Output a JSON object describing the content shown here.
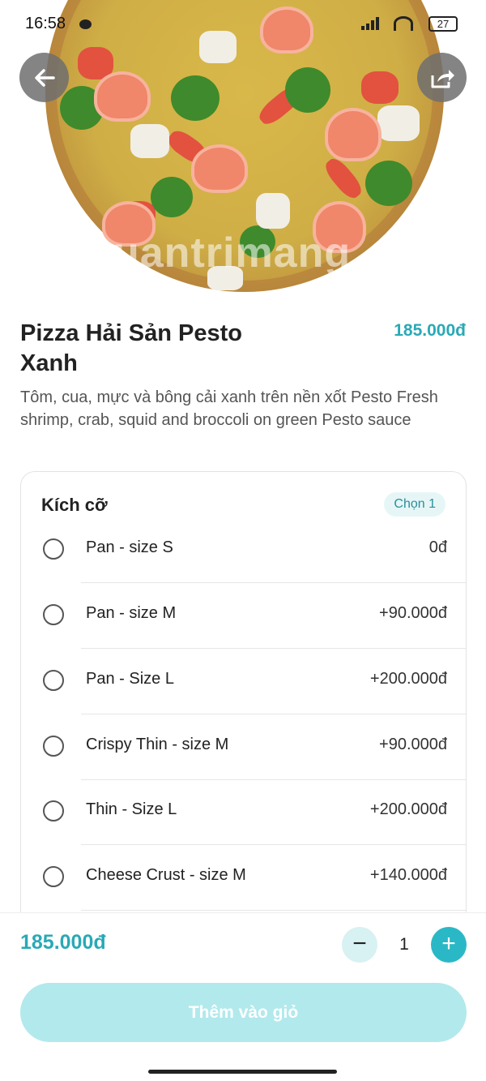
{
  "status_bar": {
    "time": "16:58",
    "battery": "27"
  },
  "hero": {
    "watermark": "uantrimang"
  },
  "product": {
    "name": "Pizza Hải Sản Pesto Xanh",
    "price": "185.000đ",
    "description": "Tôm, cua, mực và bông cải xanh trên nền xốt Pesto Fresh shrimp, crab, squid and broccoli on green Pesto sauce"
  },
  "options": {
    "title": "Kích cỡ",
    "chip": "Chọn 1",
    "items": [
      {
        "label": "Pan - size S",
        "price": "0đ"
      },
      {
        "label": "Pan - size M",
        "price": "+90.000đ"
      },
      {
        "label": "Pan - Size L",
        "price": "+200.000đ"
      },
      {
        "label": "Crispy Thin - size M",
        "price": "+90.000đ"
      },
      {
        "label": "Thin - Size L",
        "price": "+200.000đ"
      },
      {
        "label": "Cheese Crust - size M",
        "price": "+140.000đ"
      }
    ]
  },
  "footer": {
    "total": "185.000đ",
    "quantity": "1",
    "add_to_cart": "Thêm vào giỏ"
  },
  "colors": {
    "accent": "#2aa9b6",
    "button_disabled": "#b2e9ec",
    "plus_button": "#2bb8c6"
  },
  "icons": {
    "back": "arrow-left-icon",
    "share": "share-icon",
    "minus": "minus-icon",
    "plus": "plus-icon"
  }
}
